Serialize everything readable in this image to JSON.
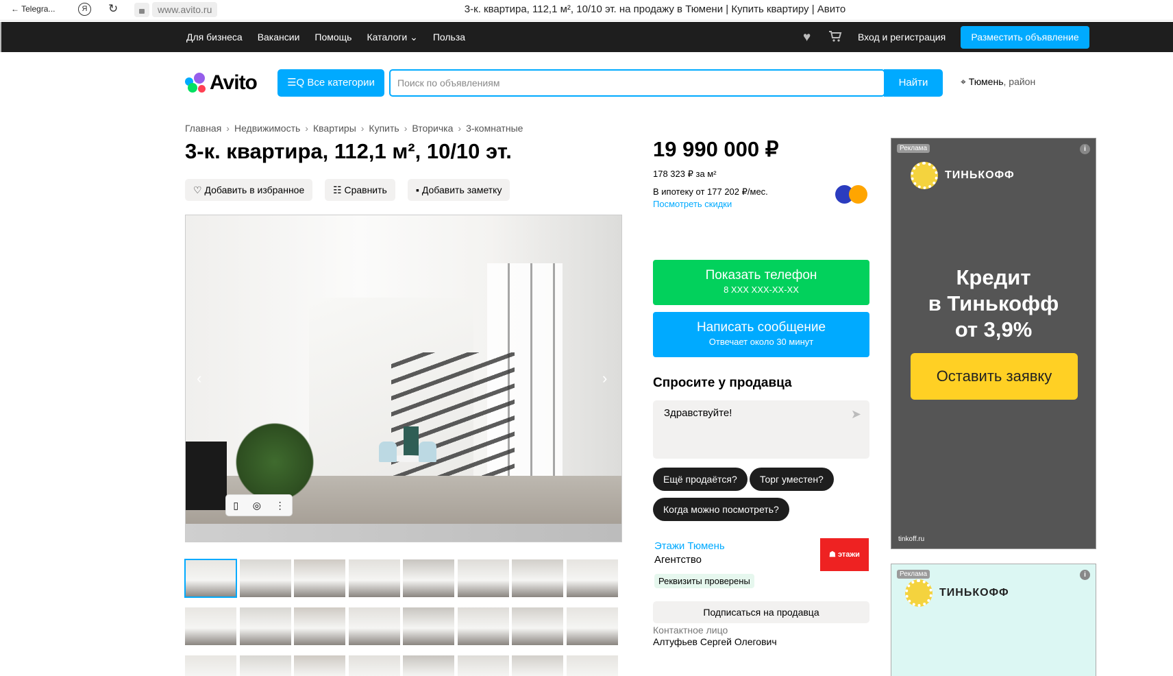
{
  "browser": {
    "back_label": "Telegra...",
    "url": "www.avito.ru",
    "title": "3-к. квартира, 112,1 м², 10/10 эт. на продажу в Тюмени | Купить квартиру | Авито"
  },
  "topnav": {
    "links": [
      "Для бизнеса",
      "Вакансии",
      "Помощь",
      "Каталоги ⌄",
      "Польза"
    ],
    "login": "Вход и регистрация",
    "post_button": "Разместить объявление"
  },
  "header": {
    "logo": "Avito",
    "categories_button": "☰Q Все категории",
    "search_placeholder": "Поиск по объявлениям",
    "find_button": "Найти",
    "location_city": "Тюмень",
    "location_region": ", район"
  },
  "breadcrumbs": [
    "Главная",
    "Недвижимость",
    "Квартиры",
    "Купить",
    "Вторичка",
    "3-комнатные"
  ],
  "listing": {
    "title": "3-к. квартира, 112,1 м², 10/10 эт.",
    "actions": {
      "favorite": "Добавить в избранное",
      "compare": "Сравнить",
      "note": "Добавить заметку"
    }
  },
  "gallery": {
    "thumbnail_count": 24,
    "selected_index": 0
  },
  "pricing": {
    "price": "19 990 000 ₽",
    "price_per_sqm": "178 323 ₽ за м²",
    "mortgage": "В ипотеку от 177 202 ₽/мес.",
    "discounts_link": "Посмотреть скидки"
  },
  "contact": {
    "phone_button": "Показать телефон",
    "phone_masked": "8 XXX XXX-XX-XX",
    "message_button": "Написать сообщение",
    "message_sub": "Отвечает около 30 минут",
    "ask_title": "Спросите у продавца",
    "message_text": "Здравствуйте!",
    "quick_replies": [
      "Ещё продаётся?",
      "Торг уместен?",
      "Когда можно посмотреть?"
    ]
  },
  "seller": {
    "name": "Этажи Тюмень",
    "type": "Агентство",
    "verified": "Реквизиты проверены",
    "logo_text": "☗ этажи",
    "subscribe": "Подписаться на продавца",
    "contact_label": "Контактное лицо",
    "contact_name": "Алтуфьев Сергей Олегович"
  },
  "ads": {
    "tag": "Реклама",
    "brand": "ТИНЬКОФФ",
    "headline": [
      "Кредит",
      "в Тинькофф",
      "от 3,9%"
    ],
    "cta": "Оставить заявку",
    "url": "tinkoff.ru"
  },
  "colors": {
    "accent": "#00aaff",
    "green": "#02d15c",
    "dark_nav": "#1e1e1e",
    "ad_yellow": "#ffd024"
  }
}
